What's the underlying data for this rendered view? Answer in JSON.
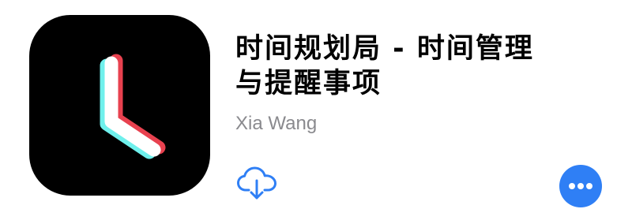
{
  "app": {
    "title_line1": "时间规划局 - 时间管理",
    "title_line2": "与提醒事项",
    "developer": "Xia Wang",
    "icon_name": "clock-hands-icon"
  },
  "actions": {
    "download_icon": "cloud-download-icon",
    "more_icon": "more-ellipsis-icon"
  },
  "colors": {
    "icon_background": "#000000",
    "icon_red": "#e8414f",
    "icon_cyan": "#6ff0ec",
    "accent": "#2f7ff5",
    "developer_text": "#8a8a8e"
  }
}
